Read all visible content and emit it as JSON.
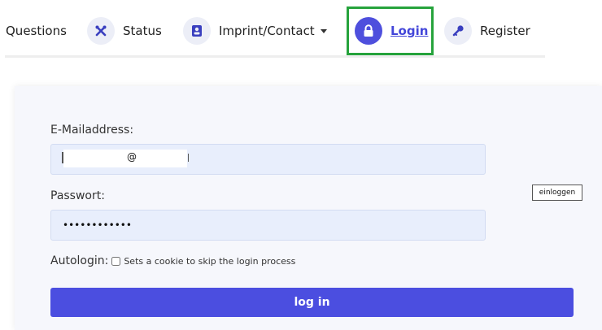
{
  "nav": {
    "questions": "Questions",
    "status": "Status",
    "imprint": "Imprint/Contact",
    "login": "Login",
    "register": "Register"
  },
  "form": {
    "email_label": "E-Mailaddress:",
    "email_visible": "@",
    "password_label": "Passwort:",
    "password_value": "••••••••••••",
    "autologin_label": "Autologin:",
    "autologin_hint": "Sets a cookie to skip the login process",
    "submit_label": "log in",
    "tooltip": "einloggen"
  },
  "colors": {
    "accent": "#4b4ee0",
    "highlight": "#26a33c"
  }
}
